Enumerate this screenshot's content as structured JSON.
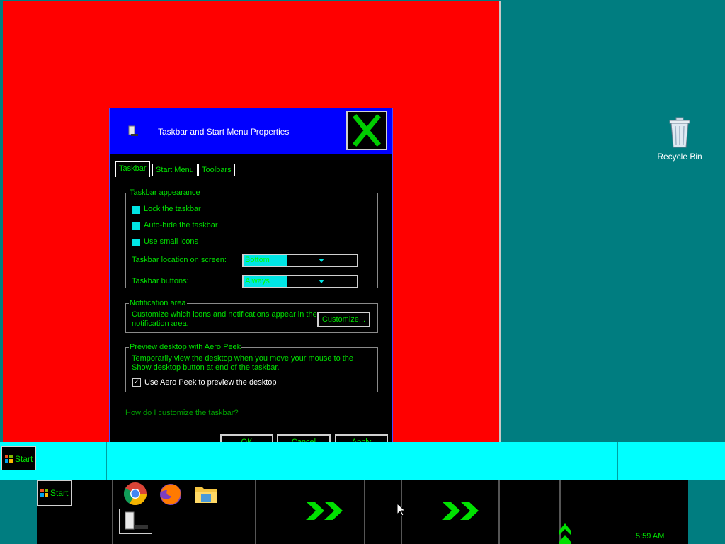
{
  "desktop": {
    "recycle_bin_label": "Recycle Bin"
  },
  "dialog": {
    "title": "Taskbar and Start Menu Properties",
    "tabs": [
      "Taskbar",
      "Start Menu",
      "Toolbars"
    ],
    "active_tab": "Taskbar",
    "taskbar_appearance": {
      "legend": "Taskbar appearance",
      "lock": "Lock the taskbar",
      "autohide": "Auto-hide the taskbar",
      "small_icons": "Use small icons",
      "location_label": "Taskbar location on screen:",
      "location_value": "Bottom",
      "buttons_label": "Taskbar buttons:",
      "buttons_value": "Always combine, hide labels"
    },
    "notification": {
      "legend": "Notification area",
      "text1": "Customize which icons and notifications appear in the",
      "text2": "notification area.",
      "customize_label": "Customize..."
    },
    "aero": {
      "legend": "Preview desktop with Aero Peek",
      "text1": "Temporarily view the desktop when you move your mouse to the",
      "text2": "Show desktop button at end of the taskbar.",
      "checkbox_label": "Use Aero Peek to preview the desktop",
      "checked": true
    },
    "help_link": "How do I customize the taskbar?",
    "buttons": {
      "ok": "OK",
      "cancel": "Cancel",
      "apply": "Apply"
    }
  },
  "taskbar": {
    "start_label": "Start",
    "clock": "5:59 AM",
    "pinned_icons": [
      "chrome-icon",
      "firefox-icon",
      "file-explorer-icon"
    ]
  },
  "colors": {
    "accent": "#00e000",
    "highlight": "#00ffff",
    "title_bar": "#0000ff"
  }
}
